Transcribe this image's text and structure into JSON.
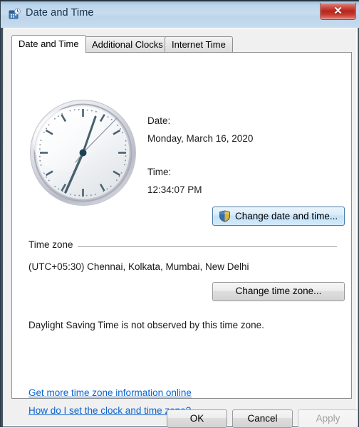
{
  "window": {
    "title": "Date and Time",
    "icon": "date-time-icon",
    "close_glyph": "✕",
    "accent_title_color": "#c9dcef",
    "close_button_color": "#b2271e"
  },
  "tabs": [
    {
      "label": "Date and Time",
      "active": true
    },
    {
      "label": "Additional Clocks",
      "active": false
    },
    {
      "label": "Internet Time",
      "active": false
    }
  ],
  "clock": {
    "name": "analog-clock",
    "hour_hand_deg": 377,
    "minute_hand_deg": 204,
    "second_hand_deg": 42,
    "displayed_time": "12:34:07 PM"
  },
  "datetime": {
    "date_label": "Date:",
    "date_value": "Monday, March 16, 2020",
    "time_label": "Time:",
    "time_value": "12:34:07 PM",
    "change_button": "Change date and time...",
    "change_button_icon": "uac-shield-icon",
    "change_button_focused": true
  },
  "timezone": {
    "group_label": "Time zone",
    "value": "(UTC+05:30) Chennai, Kolkata, Mumbai, New Delhi",
    "change_button": "Change time zone...",
    "dst_note": "Daylight Saving Time is not observed by this time zone."
  },
  "links": {
    "more_info": "Get more time zone information online",
    "how_to": "How do I set the clock and time zone?",
    "color": "#0b63ce"
  },
  "footer": {
    "ok": "OK",
    "cancel": "Cancel",
    "apply": "Apply",
    "apply_enabled": false
  }
}
